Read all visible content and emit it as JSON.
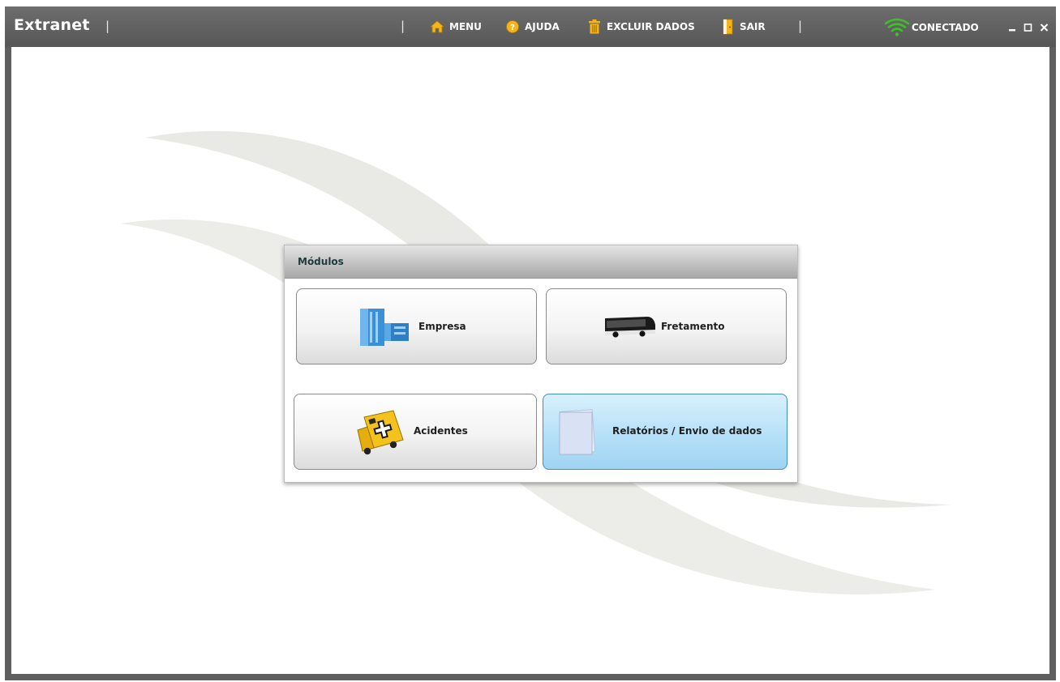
{
  "window": {
    "app_title": "Extranet",
    "separator": "|"
  },
  "nav": {
    "menu": {
      "label": "MENU",
      "icon": "home-icon"
    },
    "ajuda": {
      "label": "AJUDA",
      "icon": "help-icon"
    },
    "excluir": {
      "label": "EXCLUIR DADOS",
      "icon": "trash-icon"
    },
    "sair": {
      "label": "SAIR",
      "icon": "exit-door-icon"
    }
  },
  "status": {
    "label": "CONECTADO",
    "icon": "wifi-signal-icon",
    "color": "#3fbf2a"
  },
  "window_controls": [
    "minimize",
    "maximize",
    "close"
  ],
  "panel": {
    "title": "Módulos",
    "modules": [
      {
        "label": "Empresa",
        "icon": "building-icon",
        "active": false
      },
      {
        "label": "Fretamento",
        "icon": "bus-icon",
        "active": false
      },
      {
        "label": "Acidentes",
        "icon": "ambulance-icon",
        "active": false
      },
      {
        "label": "Relatórios / Envio de dados",
        "icon": "document-icon",
        "active": true
      }
    ]
  },
  "colors": {
    "titlebar": "#5f5f5f",
    "accent_active": "#b6e0f8",
    "panel_title": "#1e3a3a"
  }
}
